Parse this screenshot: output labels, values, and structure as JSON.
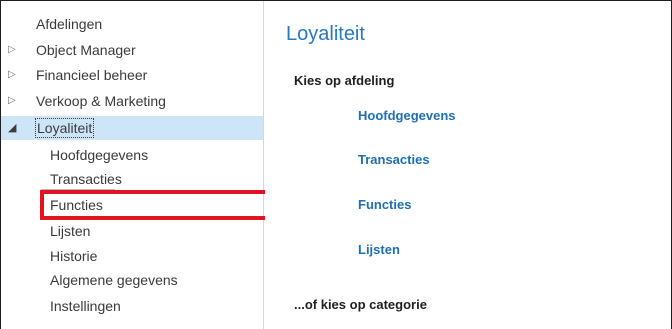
{
  "navigation": {
    "items": [
      {
        "label": "Afdelingen",
        "level": 0,
        "expander": ""
      },
      {
        "label": "Object Manager",
        "level": 0,
        "expander": "▷"
      },
      {
        "label": "Financieel beheer",
        "level": 0,
        "expander": "▷"
      },
      {
        "label": "Verkoop & Marketing",
        "level": 0,
        "expander": "▷"
      },
      {
        "label": "Loyaliteit",
        "level": 0,
        "expander": "◢",
        "selected": true
      },
      {
        "label": "Hoofdgegevens",
        "level": 1
      },
      {
        "label": "Transacties",
        "level": 1
      },
      {
        "label": "Functies",
        "level": 1,
        "highlighted": true
      },
      {
        "label": "Lijsten",
        "level": 1
      },
      {
        "label": "Historie",
        "level": 1
      },
      {
        "label": "Algemene gegevens",
        "level": 1
      },
      {
        "label": "Instellingen",
        "level": 1
      }
    ],
    "highlight_color": "#e0141e",
    "selected_background": "#cde6f7"
  },
  "main": {
    "title": "Loyaliteit",
    "department_heading": "Kies op afdeling",
    "links": [
      {
        "label": "Hoofdgegevens"
      },
      {
        "label": "Transacties"
      },
      {
        "label": "Functies"
      },
      {
        "label": "Lijsten"
      }
    ],
    "category_heading": "...of kies op categorie",
    "title_color": "#2b78c0",
    "link_color": "#1f6fb5"
  }
}
